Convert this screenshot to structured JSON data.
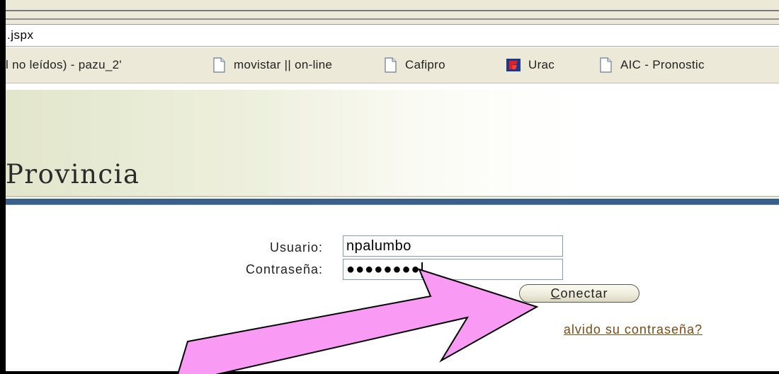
{
  "address_bar": {
    "url_fragment": ".jspx"
  },
  "bookmarks": [
    {
      "label": "l no leídos) - pazu_2'",
      "icon": "none"
    },
    {
      "label": "movistar || on-line",
      "icon": "page-icon"
    },
    {
      "label": "Cafipro",
      "icon": "page-icon"
    },
    {
      "label": "Urac",
      "icon": "red-app-icon"
    },
    {
      "label": "AIC - Pronostic",
      "icon": "page-icon"
    }
  ],
  "header": {
    "brand_text": "Provincia"
  },
  "login_form": {
    "username_label": "Usuario:",
    "username_value": "npalumbo",
    "password_label": "Contraseña:",
    "password_dots": "●●●●●●●●",
    "connect_button_first_letter": "C",
    "connect_button_rest": "onectar",
    "forgot_password_link": "alvido su contraseña?"
  },
  "colors": {
    "header_rule": "#3a5f8a",
    "annotation_arrow_fill": "#f99bf5",
    "link_color": "#7a4a12"
  }
}
